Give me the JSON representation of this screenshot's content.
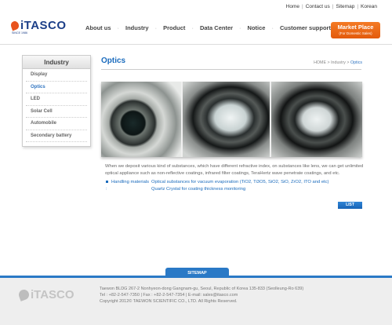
{
  "util_links": [
    "Home",
    "Contact us",
    "Sitemap",
    "Korean"
  ],
  "logo": {
    "word": "iTASCO",
    "since": "SINCE 1986"
  },
  "nav": [
    "About us",
    "Industry",
    "Product",
    "Data Center",
    "Notice",
    "Customer support"
  ],
  "market": {
    "title": "Market Place",
    "sub": "(For Domestic Sales)"
  },
  "sidebar": {
    "title": "Industry",
    "items": [
      {
        "label": "Display",
        "active": false
      },
      {
        "label": "Optics",
        "active": true
      },
      {
        "label": "LED",
        "active": false
      },
      {
        "label": "Solar Cell",
        "active": false
      },
      {
        "label": "Automobile",
        "active": false
      },
      {
        "label": "Secondary battery",
        "active": false
      }
    ]
  },
  "page": {
    "title": "Optics",
    "breadcrumb": {
      "home": "HOME",
      "sep": ">",
      "parent": "Industry",
      "current": "Optics"
    }
  },
  "content": {
    "desc": "When we deposit various kind of substances, which have different refractive index, on substances like lens, we can get unlimited optical appliance such as non-reflective coatings, infrared filter coatings, TeraHertz wave penetrate coatings, and etc.",
    "handling_label": "Handling materials :",
    "handling_lines": [
      "Optical substances for vacuum evaporation (TiO2, Ti3O5, SiO2, SiO, ZrO2, ITO and etc)",
      "Quartz Crystal for coating thickness monitoring"
    ],
    "list_button": "LIST"
  },
  "footer": {
    "sitemap": "SITEMAP",
    "logo": "iTASCO",
    "lines": [
      "Taewon BLDG 267-2 Nonhyeon-dong Gangnam-gu, Seoul, Republic of Korea 135-833 (Seolleung-Ro 639)",
      "Tel : +82-2-547-7350  |  Fax : +82-2-547-7354  |  E-mail: sales@itasco.com",
      "Copyright 2012© TAEWON SCIENTIFIC CO., LTD. All Rights Reserved."
    ]
  },
  "colors": {
    "brand_blue": "#1a6bbd",
    "accent_orange": "#e35a0c",
    "footer_blue": "#2a79c6"
  }
}
